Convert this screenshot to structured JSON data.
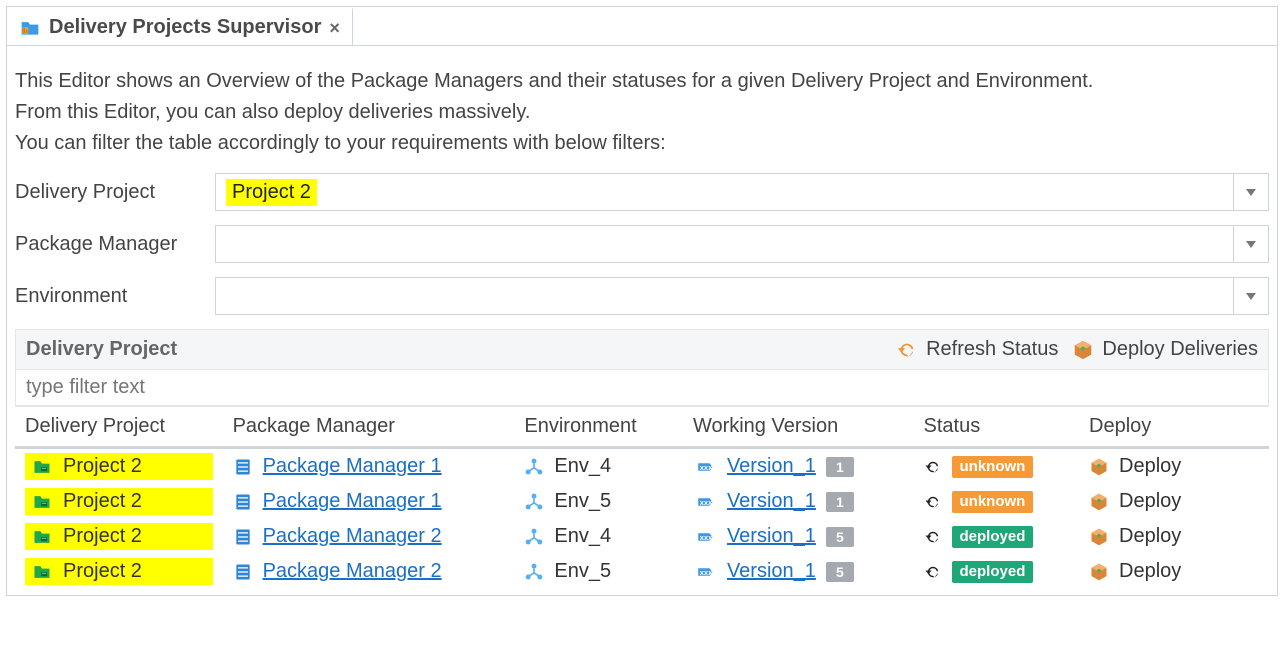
{
  "tab": {
    "title": "Delivery Projects Supervisor"
  },
  "description": {
    "line1": "This Editor shows an Overview of the Package Managers and their statuses for a given Delivery Project and Environment.",
    "line2": "From this Editor, you can also deploy deliveries massively.",
    "line3": "You can filter the table accordingly to your requirements with below filters:"
  },
  "filters": {
    "labels": {
      "project": "Delivery Project",
      "pkgmgr": "Package Manager",
      "env": "Environment"
    },
    "values": {
      "project": "Project 2",
      "pkgmgr": "",
      "env": ""
    }
  },
  "section": {
    "title": "Delivery Project",
    "actions": {
      "refresh": "Refresh Status",
      "deploy": "Deploy Deliveries"
    }
  },
  "filter_input_placeholder": "type filter text",
  "columns": {
    "project": "Delivery Project",
    "pkgmgr": "Package Manager",
    "env": "Environment",
    "workver": "Working Version",
    "status": "Status",
    "deploy": "Deploy"
  },
  "status_labels": {
    "unknown": "unknown",
    "deployed": "deployed"
  },
  "rows": [
    {
      "project": "Project 2",
      "pkgmgr": "Package Manager 1",
      "env": "Env_4",
      "workver": "Version_1",
      "workver_badge": "1",
      "status": "unknown",
      "deploy": "Deploy"
    },
    {
      "project": "Project 2",
      "pkgmgr": "Package Manager 1",
      "env": "Env_5",
      "workver": "Version_1",
      "workver_badge": "1",
      "status": "unknown",
      "deploy": "Deploy"
    },
    {
      "project": "Project 2",
      "pkgmgr": "Package Manager 2",
      "env": "Env_4",
      "workver": "Version_1",
      "workver_badge": "5",
      "status": "deployed",
      "deploy": "Deploy"
    },
    {
      "project": "Project 2",
      "pkgmgr": "Package Manager 2",
      "env": "Env_5",
      "workver": "Version_1",
      "workver_badge": "5",
      "status": "deployed",
      "deploy": "Deploy"
    }
  ]
}
